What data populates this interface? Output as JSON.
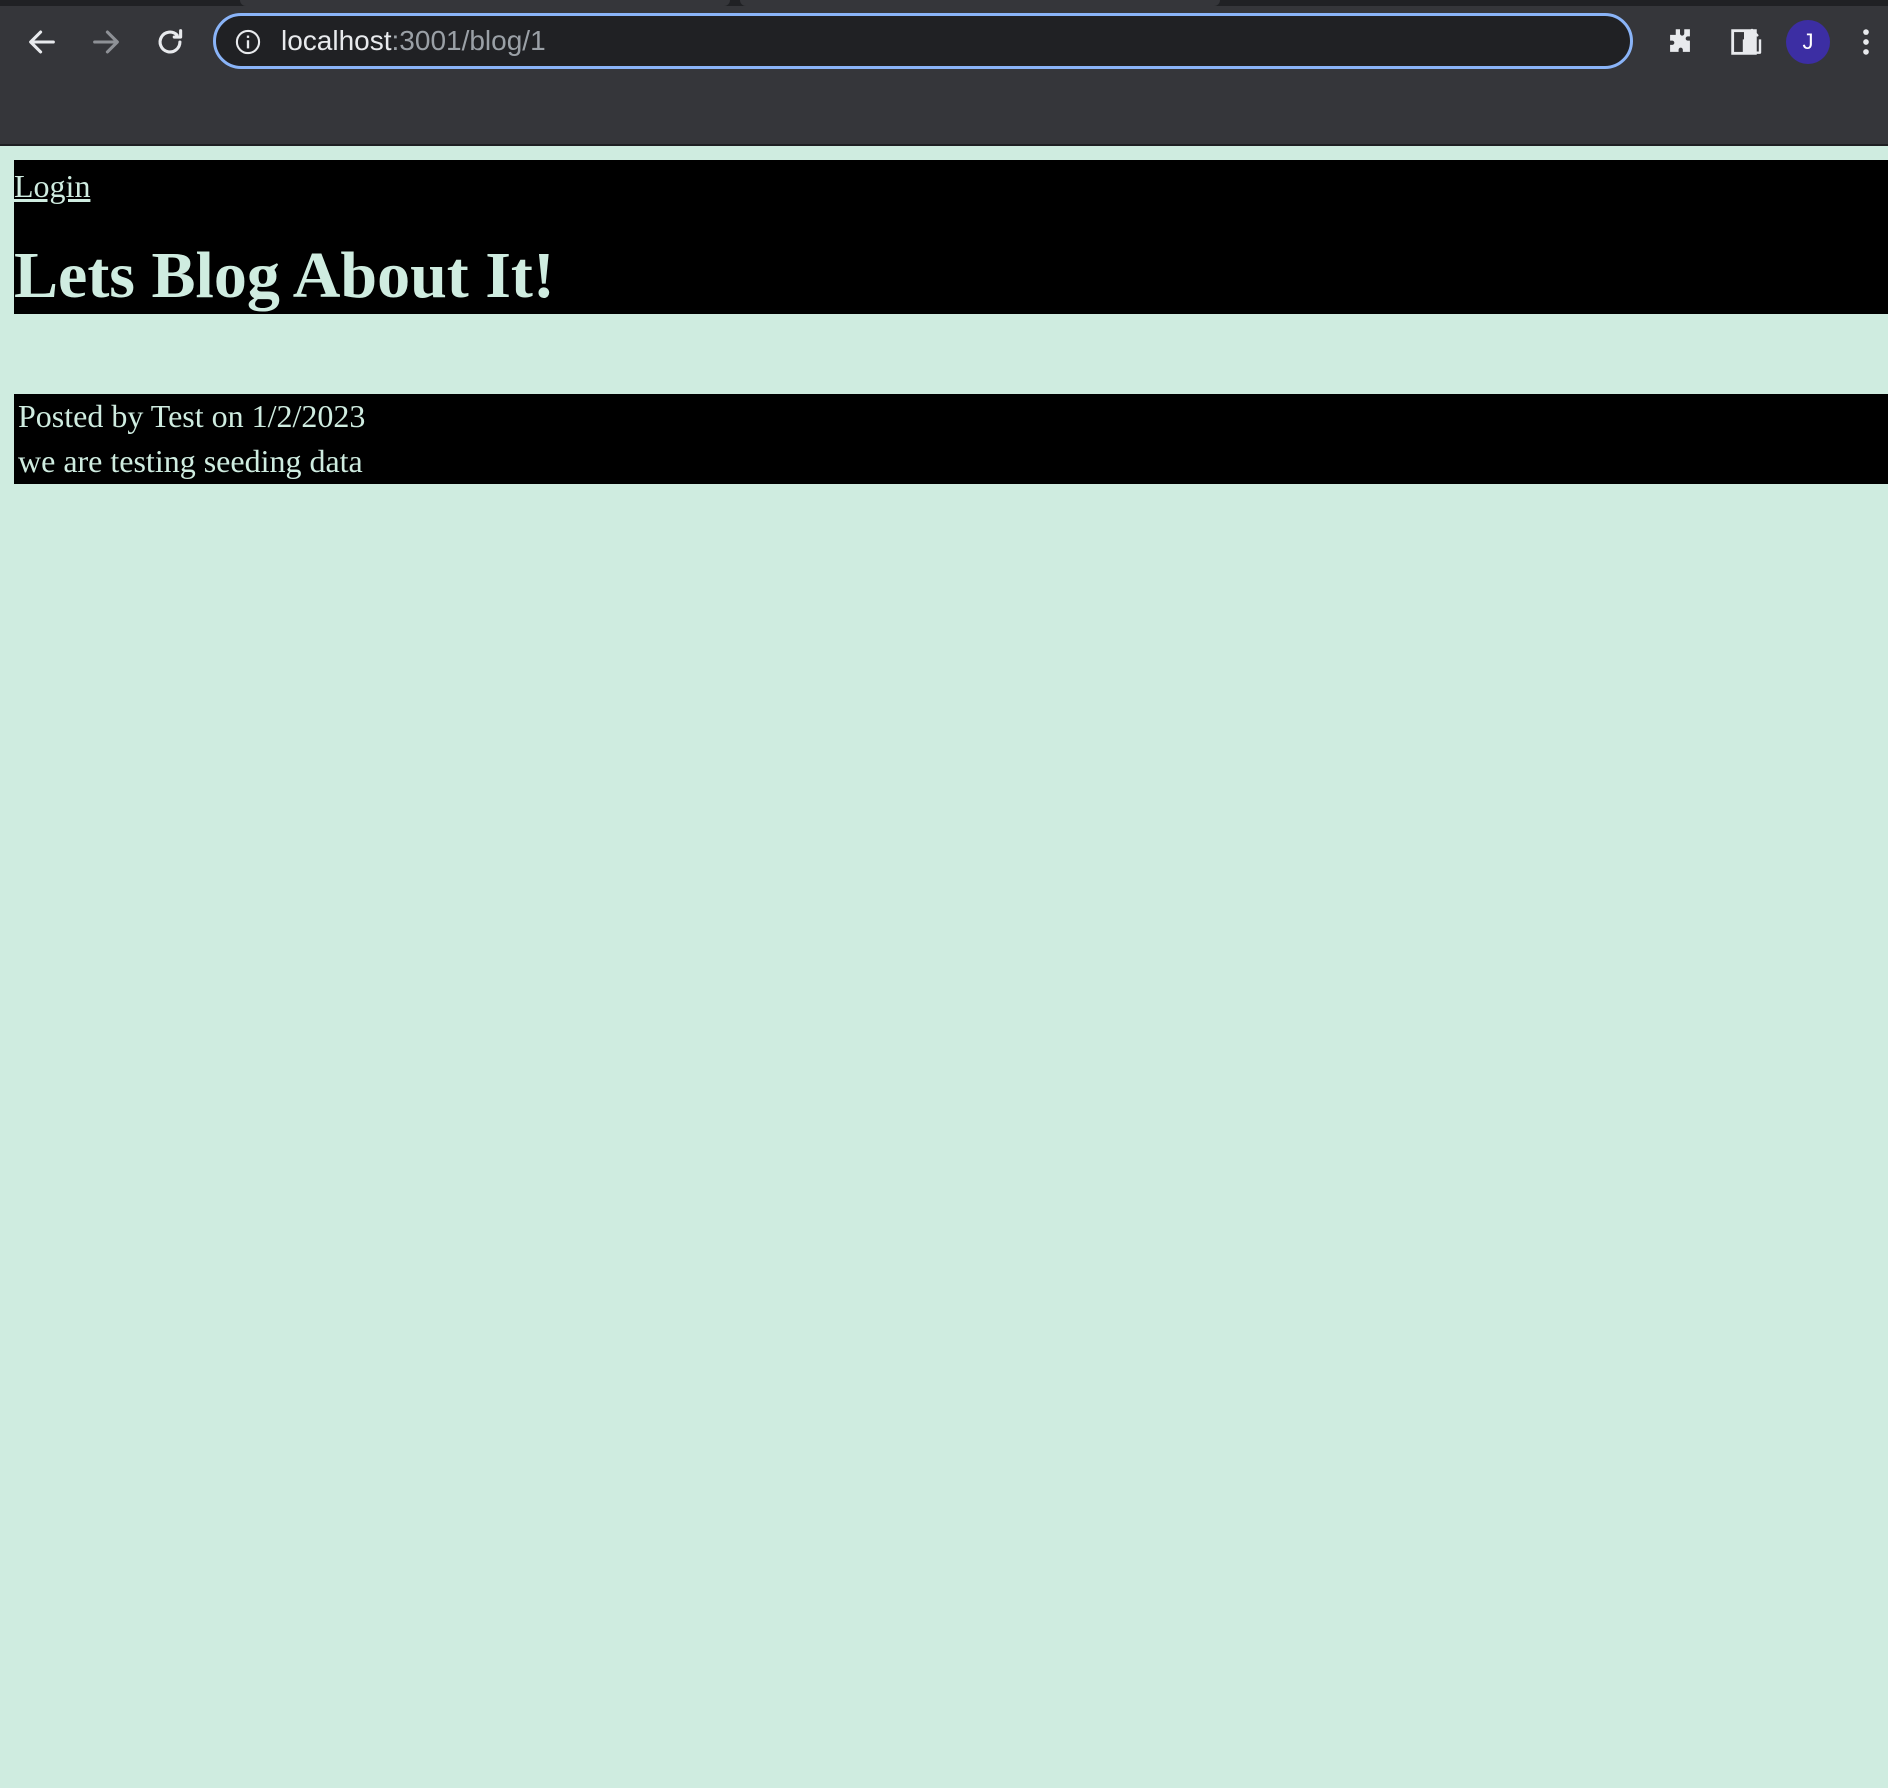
{
  "browser": {
    "url_host": "localhost",
    "url_path": ":3001/blog/1",
    "avatar_initial": "J",
    "icons": {
      "back": "arrow-left-icon",
      "forward": "arrow-right-icon",
      "reload": "reload-icon",
      "site_info": "info-icon",
      "share": "share-icon",
      "bookmark": "star-icon",
      "extensions": "puzzle-icon",
      "side_panel": "side-panel-icon",
      "menu": "kebab-menu-icon"
    }
  },
  "header": {
    "login_label": "Login",
    "title": "Lets Blog About It!"
  },
  "posts": [
    {
      "meta": "Posted by Test on 1/2/2023",
      "body": "we are testing seeding data"
    }
  ],
  "colors": {
    "page_background": "#cfece0",
    "panel_background": "#000000",
    "text": "#cfece0",
    "omnibox_focus": "#8ab4f8",
    "avatar": "#3c2ea3"
  }
}
